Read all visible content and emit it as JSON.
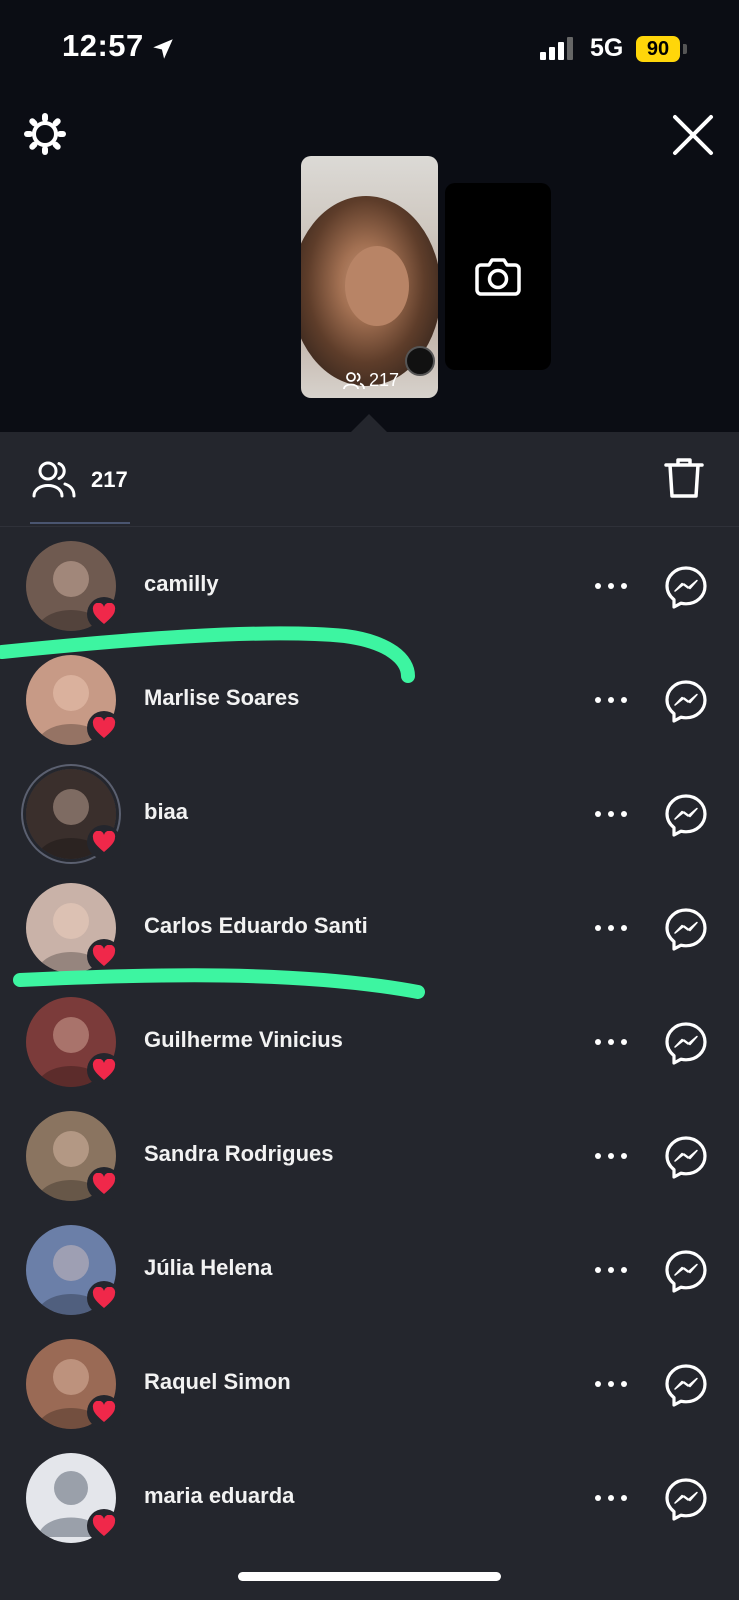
{
  "status_bar": {
    "time": "12:57",
    "network": "5G",
    "battery": "90"
  },
  "story": {
    "viewer_count": "217"
  },
  "viewers_header": {
    "count": "217"
  },
  "viewers": [
    {
      "name": "camilly",
      "avatar_color": "#6f5a50"
    },
    {
      "name": "Marlise Soares",
      "avatar_color": "#c79a86"
    },
    {
      "name": "biaa",
      "avatar_color": "#3a2f2c"
    },
    {
      "name": "Carlos Eduardo Santi",
      "avatar_color": "#c9b2a8"
    },
    {
      "name": "Guilherme Vinicius",
      "avatar_color": "#7b3b3a"
    },
    {
      "name": "Sandra Rodrigues",
      "avatar_color": "#8a7460"
    },
    {
      "name": "Júlia Helena",
      "avatar_color": "#6b7fa8"
    },
    {
      "name": "Raquel Simon",
      "avatar_color": "#9a6a55"
    },
    {
      "name": "maria eduarda",
      "avatar_color": "#e4e6eb"
    }
  ],
  "colors": {
    "heart": "#f0284a",
    "highlight": "#3df5a1",
    "battery": "#ffd60a"
  }
}
